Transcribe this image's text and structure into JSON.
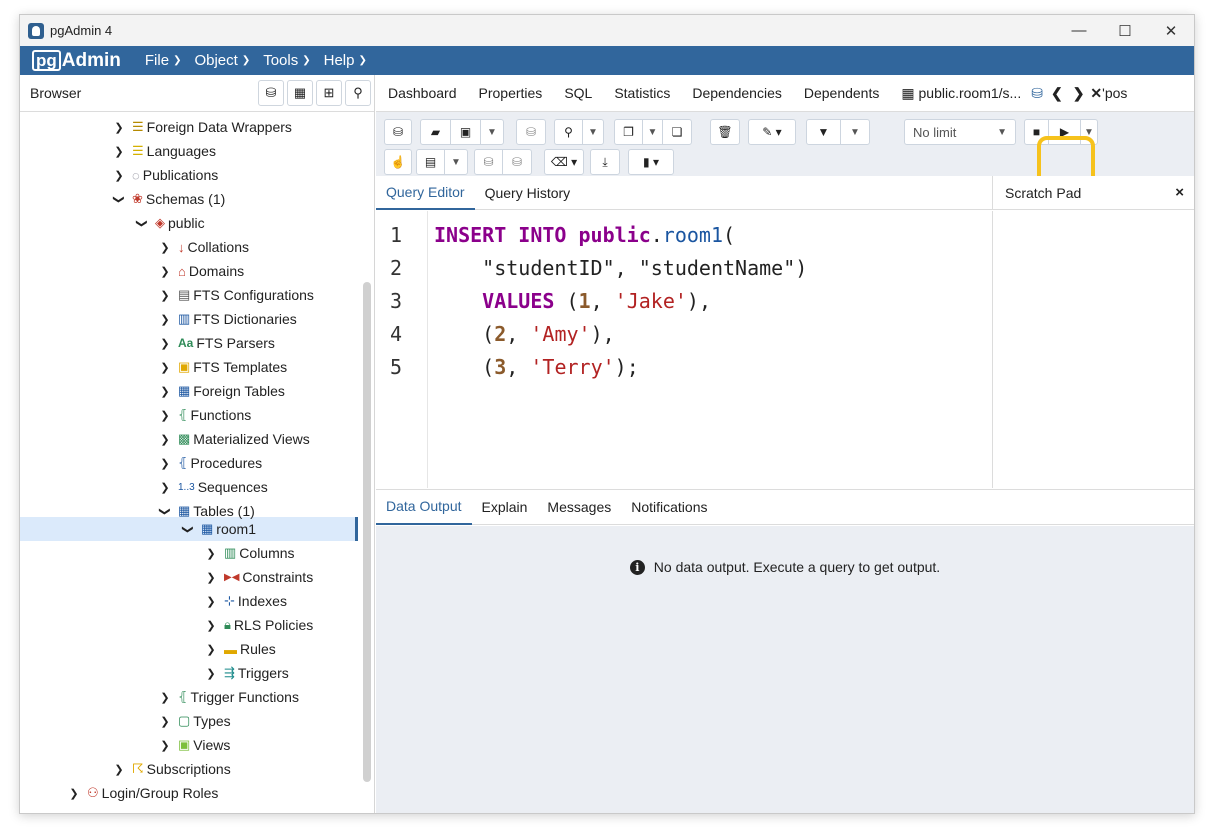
{
  "window": {
    "title": "pgAdmin 4",
    "minimize": "—",
    "maximize": "☐",
    "close": "✕"
  },
  "menubar": {
    "logo_pg": "pg",
    "logo_admin": "Admin",
    "items": [
      {
        "label": "File"
      },
      {
        "label": "Object"
      },
      {
        "label": "Tools"
      },
      {
        "label": "Help"
      }
    ]
  },
  "browser": {
    "title": "Browser",
    "tree": [
      {
        "label": "Foreign Data Wrappers",
        "icon": "foreign-data-wrapper-icon",
        "expanded": false
      },
      {
        "label": "Languages",
        "icon": "language-icon",
        "expanded": false
      },
      {
        "label": "Publications",
        "icon": "publication-icon",
        "expanded": false
      },
      {
        "label": "Schemas (1)",
        "icon": "schema-icon",
        "expanded": true
      },
      {
        "label": "public",
        "icon": "public-schema-icon",
        "expanded": true
      },
      {
        "label": "Collations",
        "icon": "collation-icon",
        "expanded": false
      },
      {
        "label": "Domains",
        "icon": "domain-icon",
        "expanded": false
      },
      {
        "label": "FTS Configurations",
        "icon": "fts-config-icon",
        "expanded": false
      },
      {
        "label": "FTS Dictionaries",
        "icon": "fts-dictionary-icon",
        "expanded": false
      },
      {
        "label": "FTS Parsers",
        "icon": "fts-parser-icon",
        "expanded": false
      },
      {
        "label": "FTS Templates",
        "icon": "fts-template-icon",
        "expanded": false
      },
      {
        "label": "Foreign Tables",
        "icon": "foreign-table-icon",
        "expanded": false
      },
      {
        "label": "Functions",
        "icon": "function-icon",
        "expanded": false
      },
      {
        "label": "Materialized Views",
        "icon": "materialized-view-icon",
        "expanded": false
      },
      {
        "label": "Procedures",
        "icon": "procedure-icon",
        "expanded": false
      },
      {
        "label": "Sequences",
        "icon": "sequence-icon",
        "expanded": false
      },
      {
        "label": "Tables (1)",
        "icon": "tables-icon",
        "expanded": true
      },
      {
        "label": "room1",
        "icon": "table-icon",
        "expanded": true,
        "selected": true
      },
      {
        "label": "Columns",
        "icon": "columns-icon",
        "expanded": false
      },
      {
        "label": "Constraints",
        "icon": "constraints-icon",
        "expanded": false
      },
      {
        "label": "Indexes",
        "icon": "indexes-icon",
        "expanded": false
      },
      {
        "label": "RLS Policies",
        "icon": "rls-policy-icon",
        "expanded": false
      },
      {
        "label": "Rules",
        "icon": "rules-icon",
        "expanded": false
      },
      {
        "label": "Triggers",
        "icon": "triggers-icon",
        "expanded": false
      },
      {
        "label": "Trigger Functions",
        "icon": "trigger-function-icon",
        "expanded": false
      },
      {
        "label": "Types",
        "icon": "types-icon",
        "expanded": false
      },
      {
        "label": "Views",
        "icon": "views-icon",
        "expanded": false
      },
      {
        "label": "Subscriptions",
        "icon": "subscription-icon",
        "expanded": false
      },
      {
        "label": "Login/Group Roles",
        "icon": "roles-icon",
        "expanded": false
      }
    ]
  },
  "main_tabs": {
    "items": [
      "Dashboard",
      "Properties",
      "SQL",
      "Statistics",
      "Dependencies",
      "Dependents",
      "public.room1/s..."
    ],
    "overflow": "'pos"
  },
  "toolbar": {
    "no_limit": "No limit"
  },
  "editor_tabs": {
    "query_editor": "Query Editor",
    "query_history": "Query History",
    "scratch_pad": "Scratch Pad",
    "close": "×"
  },
  "editor": {
    "line_numbers": [
      "1",
      "2",
      "3",
      "4",
      "5"
    ]
  },
  "output_tabs": {
    "data_output": "Data Output",
    "explain": "Explain",
    "messages": "Messages",
    "notifications": "Notifications"
  },
  "output": {
    "message": "No data output. Execute a query to get output."
  },
  "colors": {
    "brand": "#31669c",
    "highlight": "#f6c21c",
    "toolbar_bg": "#ebeef3"
  }
}
